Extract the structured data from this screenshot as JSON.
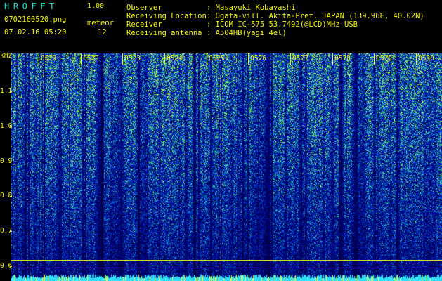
{
  "app": {
    "name": "HROFFT",
    "version": "1.00"
  },
  "file": {
    "name": "0702160520.png",
    "timestamp": "07.02.16 05:20"
  },
  "meteor": {
    "label": "meteor",
    "count": "12"
  },
  "info": [
    {
      "label": "Observer",
      "value": ": Masayuki Kobayashi"
    },
    {
      "label": "Receiving Location",
      "value": ": Ogata-vill. Akita-Pref. JAPAN (139.96E, 40.02N)"
    },
    {
      "label": "Receiver",
      "value": ": ICOM IC-575 53.7492(@LCD)MHz USB"
    },
    {
      "label": "Receiving antenna",
      "value": ": A504HB(yagi 4el)"
    }
  ],
  "axis": {
    "unit": "kHz",
    "ticks": [
      "1.1",
      "1.0",
      "0.9",
      "0.8",
      "0.7",
      "0.6"
    ]
  },
  "minutes": [
    "0521",
    "0522",
    "0523",
    "0524",
    "0525",
    "0526",
    "0527",
    "0528",
    "0529",
    "0530"
  ],
  "colors": {
    "text": "#f2f20a",
    "brand": "#18e0c8",
    "baseline": "#d7d73a"
  }
}
